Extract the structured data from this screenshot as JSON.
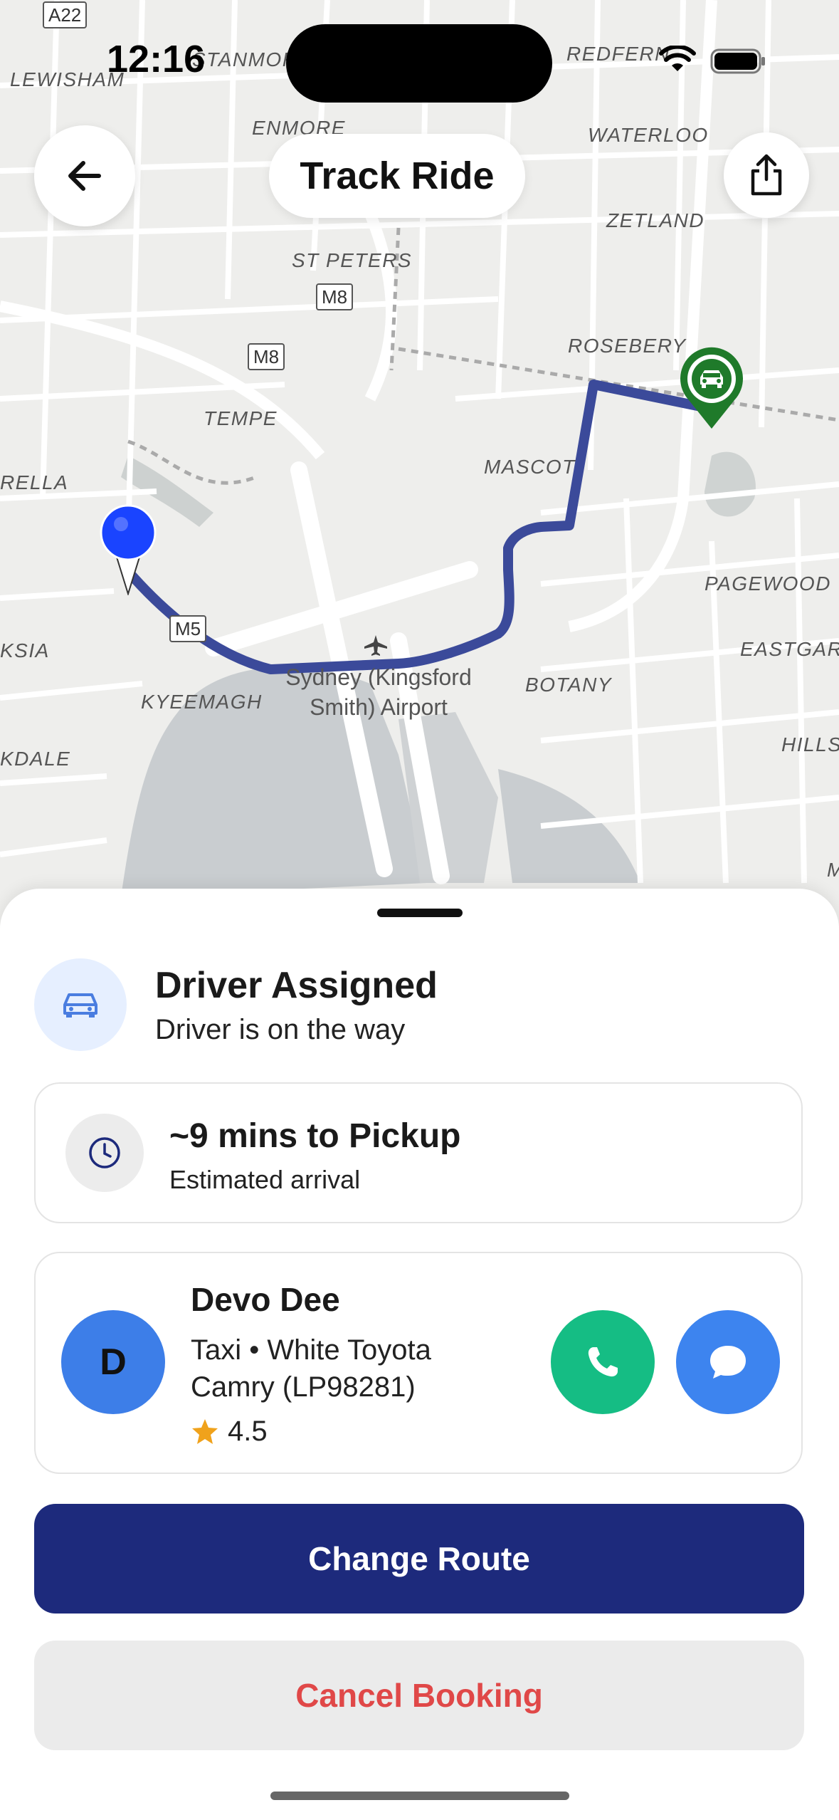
{
  "status_bar": {
    "time": "12:16"
  },
  "header": {
    "title": "Track Ride",
    "back_icon": "arrow-left-icon",
    "share_icon": "share-icon"
  },
  "map": {
    "labels": {
      "lewisham": "LEWISHAM",
      "stanmore": "STANMORE",
      "enmore": "ENMORE",
      "redfern": "REDFERN",
      "waterloo": "WATERLOO",
      "zetland": "ZETLAND",
      "st_peters": "ST PETERS",
      "rosebery": "ROSEBERY",
      "tempe": "TEMPE",
      "rella": "RELLA",
      "mascot": "MASCOT",
      "pagewood": "PAGEWOOD",
      "eastgardens": "EASTGARD",
      "ksia": "KSIA",
      "kyeemagh": "KYEEMAGH",
      "botany": "BOTANY",
      "hills": "HILLS",
      "kdale": "KDALE",
      "m_edge": "M",
      "airport_line1": "Sydney (Kingsford",
      "airport_line2": "Smith) Airport"
    },
    "road_badges": {
      "a22": "A22",
      "m8_top": "M8",
      "m8_left": "M8",
      "m5": "M5"
    },
    "colors": {
      "route": "#3b4a9a",
      "driver_pin": "#1f7a2a",
      "pickup_pin": "#1a4dff"
    }
  },
  "status": {
    "title": "Driver Assigned",
    "subtitle": "Driver is on the way",
    "icon": "car-icon"
  },
  "eta": {
    "title": "~9 mins to Pickup",
    "subtitle": "Estimated arrival",
    "icon": "clock-icon"
  },
  "driver": {
    "initial": "D",
    "name": "Devo Dee",
    "vehicle": "Taxi • White Toyota Camry (LP98281)",
    "rating": "4.5",
    "rating_icon": "star-icon"
  },
  "actions": {
    "change_route": "Change Route",
    "cancel_booking": "Cancel Booking"
  },
  "colors": {
    "primary": "#1d2a7c",
    "danger": "#e04848",
    "call": "#15bd84",
    "chat": "#3d84ef",
    "avatar": "#3d7ee8"
  }
}
